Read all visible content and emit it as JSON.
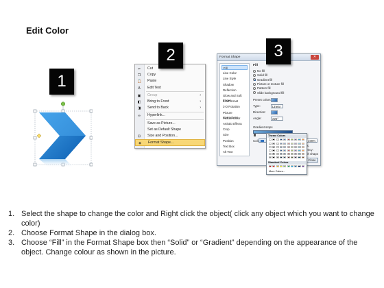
{
  "title": "Edit Color",
  "badges": [
    "1",
    "2",
    "3"
  ],
  "context_menu": {
    "items": [
      {
        "label": "Cut",
        "icon": "scissors-icon",
        "glyph": "✂",
        "enabled": true
      },
      {
        "label": "Copy",
        "icon": "copy-icon",
        "glyph": "❐",
        "enabled": true
      },
      {
        "label": "Paste",
        "icon": "paste-icon",
        "glyph": "📋",
        "enabled": true
      },
      {
        "label": "Edit Text",
        "icon": "edit-text-icon",
        "glyph": "A",
        "enabled": true
      },
      {
        "label": "Group",
        "icon": "group-icon",
        "glyph": "▣",
        "enabled": false,
        "submenu": true
      },
      {
        "label": "Bring to Front",
        "icon": "bring-front-icon",
        "glyph": "◧",
        "enabled": true,
        "submenu": true
      },
      {
        "label": "Send to Back",
        "icon": "send-back-icon",
        "glyph": "◨",
        "enabled": true,
        "submenu": true
      },
      {
        "label": "Hyperlink...",
        "icon": "hyperlink-icon",
        "glyph": "∞",
        "enabled": true
      },
      {
        "label": "Save as Picture...",
        "icon": "",
        "glyph": "",
        "enabled": true
      },
      {
        "label": "Set as Default Shape",
        "icon": "",
        "glyph": "",
        "enabled": true
      },
      {
        "label": "Size and Position...",
        "icon": "size-icon",
        "glyph": "⊡",
        "enabled": true
      },
      {
        "label": "Format Shape...",
        "icon": "format-shape-icon",
        "glyph": "◈",
        "enabled": true,
        "highlighted": true
      }
    ]
  },
  "format_dialog": {
    "title": "Format Shape",
    "close_glyph": "✕",
    "nav": [
      "Fill",
      "Line Color",
      "Line Style",
      "Shadow",
      "Reflection",
      "Glow and Soft Edges",
      "3-D Format",
      "3-D Rotation",
      "Picture Corrections",
      "Picture Color",
      "Artistic Effects",
      "Crop",
      "Size",
      "Position",
      "Text Box",
      "Alt Text"
    ],
    "section": "Fill",
    "fill_options": [
      {
        "label": "No fill",
        "on": false
      },
      {
        "label": "Solid fill",
        "on": false
      },
      {
        "label": "Gradient fill",
        "on": true
      },
      {
        "label": "Picture or texture fill",
        "on": false
      },
      {
        "label": "Pattern fill",
        "on": false
      },
      {
        "label": "Slide background fill",
        "on": false
      }
    ],
    "fields": [
      {
        "label": "Preset colors:"
      },
      {
        "label": "Type:",
        "value": "Linear"
      },
      {
        "label": "Direction:"
      },
      {
        "label": "Angle:",
        "value": "225°"
      }
    ],
    "gradient_stops_label": "Gradient stops",
    "color_label": "Color",
    "position_label": "Position:",
    "position_value": "100%",
    "brightness_label": "Brightness:",
    "transparency_label": "Transparency:",
    "rotate_label": "Rotate with shape",
    "close_label": "Close"
  },
  "palette": {
    "theme_header": "Theme Colors",
    "standard_header": "Standard Colors",
    "more_colors": "More Colors...",
    "theme_columns": [
      "#ffffff",
      "#000000",
      "#eeece1",
      "#1f497d",
      "#4f81bd",
      "#c0504d",
      "#9bbb59",
      "#8064a2",
      "#4bacc6",
      "#f79646"
    ],
    "standard": [
      "#c00000",
      "#ff0000",
      "#ffc000",
      "#ffff00",
      "#92d050",
      "#00b050",
      "#00b0f0",
      "#0070c0",
      "#002060",
      "#7030a0"
    ]
  },
  "instructions": [
    {
      "num": "1.",
      "text": "Select the shape to change the color and Right click the object( click any object which you want to change color)"
    },
    {
      "num": "2.",
      "text": "Choose Format Shape in the dialog box."
    },
    {
      "num": "3.",
      "text": "Choose “Fill” in the Format Shape box then “Solid” or “Gradient” depending on the appearance of the object. Change colour as shown in the picture."
    }
  ]
}
